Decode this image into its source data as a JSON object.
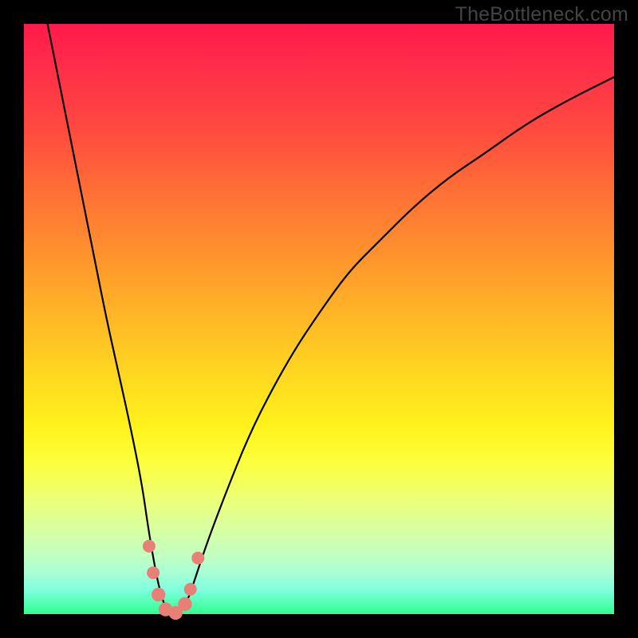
{
  "watermark": "TheBottleneck.com",
  "chart_data": {
    "type": "line",
    "title": "",
    "xlabel": "",
    "ylabel": "",
    "xlim": [
      0,
      100
    ],
    "ylim": [
      0,
      100
    ],
    "series": [
      {
        "name": "bottleneck-curve",
        "x": [
          4,
          6,
          8,
          10,
          12,
          14,
          16,
          18,
          20,
          21,
          22,
          23,
          24,
          25,
          26,
          27,
          28,
          29,
          31,
          34,
          38,
          42,
          46,
          50,
          55,
          60,
          66,
          72,
          78,
          85,
          92,
          100
        ],
        "y": [
          100,
          90,
          80,
          70,
          60,
          50,
          41,
          32,
          22,
          15,
          9,
          4,
          1,
          0,
          0,
          1,
          3,
          6,
          12,
          20,
          30,
          38,
          45,
          51,
          58,
          63,
          69,
          74,
          78,
          83,
          87,
          91
        ]
      }
    ],
    "markers": [
      {
        "x": 21.2,
        "y": 11.5,
        "r": 1.2,
        "color": "#e98078"
      },
      {
        "x": 21.9,
        "y": 7.0,
        "r": 1.2,
        "color": "#e98078"
      },
      {
        "x": 22.8,
        "y": 3.3,
        "r": 1.3,
        "color": "#e98078"
      },
      {
        "x": 24.0,
        "y": 0.8,
        "r": 1.3,
        "color": "#e98078"
      },
      {
        "x": 25.7,
        "y": 0.2,
        "r": 1.3,
        "color": "#e98078"
      },
      {
        "x": 27.3,
        "y": 1.7,
        "r": 1.3,
        "color": "#e98078"
      },
      {
        "x": 28.2,
        "y": 4.2,
        "r": 1.2,
        "color": "#e98078"
      },
      {
        "x": 29.5,
        "y": 9.5,
        "r": 1.2,
        "color": "#e98078"
      }
    ],
    "gradient_stops": [
      {
        "pos": 0,
        "color": "#ff1a4b"
      },
      {
        "pos": 50,
        "color": "#ffb127"
      },
      {
        "pos": 75,
        "color": "#fff21c"
      },
      {
        "pos": 100,
        "color": "#30ff8a"
      }
    ]
  }
}
